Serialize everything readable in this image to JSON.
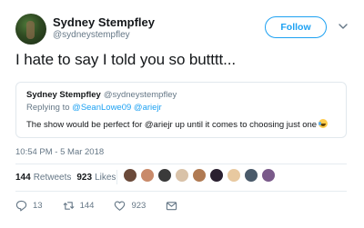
{
  "author": {
    "name": "Sydney Stempfley",
    "handle": "@sydneystempfley"
  },
  "follow_label": "Follow",
  "tweet_text": "I hate to say I told you so butttt...",
  "quoted": {
    "name": "Sydney Stempfley",
    "handle": "@sydneystempfley",
    "replying_prefix": "Replying to",
    "replying_to": "@SeanLowe09 @ariejr",
    "text": "The show would be perfect for @ariejr up until it comes to choosing just one"
  },
  "timestamp": "10:54 PM - 5 Mar 2018",
  "stats": {
    "retweets_count": "144",
    "retweets_label": "Retweets",
    "likes_count": "923",
    "likes_label": "Likes"
  },
  "liker_avatar_colors": [
    "#6b4a3a",
    "#c98a6a",
    "#3a3a3a",
    "#d9c2a8",
    "#b07a52",
    "#2a2030",
    "#e8c9a0",
    "#4a5a6a",
    "#7a5a8a"
  ],
  "actions": {
    "replies": "13",
    "retweets": "144",
    "likes": "923"
  },
  "colors": {
    "accent": "#1da1f2",
    "secondary_text": "#657786"
  }
}
